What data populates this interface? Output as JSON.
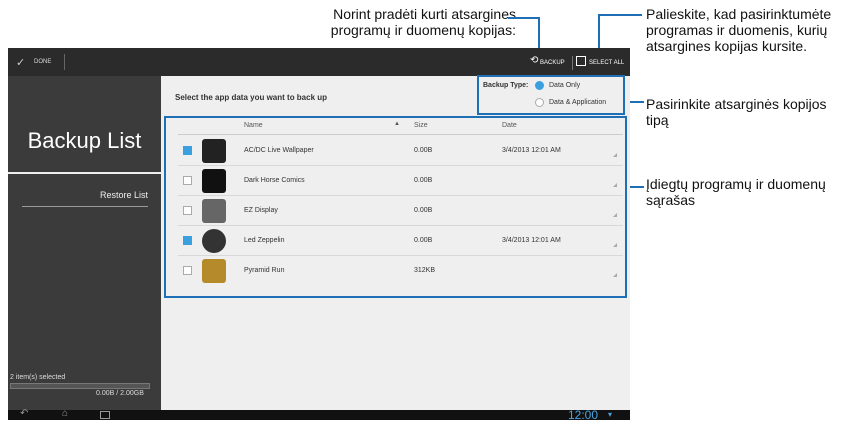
{
  "callouts": {
    "backup": "Norint pradėti kurti atsargines programų ir duomenų kopijas:",
    "select_all": "Palieskite, kad pasirinktumėte programas ir duomenis, kurių atsargines kopijas kursite.",
    "backup_type": "Pasirinkite atsarginės kopijos tipą",
    "app_list": "Įdiegtų programų ir duomenų sąrašas"
  },
  "topbar": {
    "done_label": "DONE",
    "backup_label": "BACKUP",
    "select_all_label": "SELECT ALL"
  },
  "sidebar": {
    "title": "Backup List",
    "restore_label": "Restore List",
    "selected_count": "2 item(s) selected",
    "storage": "0.00B / 2.00GB"
  },
  "main": {
    "instruction": "Select the app data you want to back up",
    "backup_type_label": "Backup Type:",
    "option_data_only": "Data Only",
    "option_data_app": "Data & Application",
    "columns": {
      "name": "Name",
      "size": "Size",
      "date": "Date"
    },
    "rows": [
      {
        "name": "AC/DC Live Wallpaper",
        "size": "0.00B",
        "date": "3/4/2013 12:01 AM",
        "checked": true
      },
      {
        "name": "Dark Horse Comics",
        "size": "0.00B",
        "date": "",
        "checked": false
      },
      {
        "name": "EZ Display",
        "size": "0.00B",
        "date": "",
        "checked": false
      },
      {
        "name": "Led Zeppelin",
        "size": "0.00B",
        "date": "3/4/2013 12:01 AM",
        "checked": true
      },
      {
        "name": "Pyramid Run",
        "size": "312KB",
        "date": "",
        "checked": false
      }
    ]
  },
  "statusbar": {
    "time": "12:00"
  },
  "colors": {
    "accent": "#3aa0e0",
    "callout_line": "#1f6fb6"
  }
}
